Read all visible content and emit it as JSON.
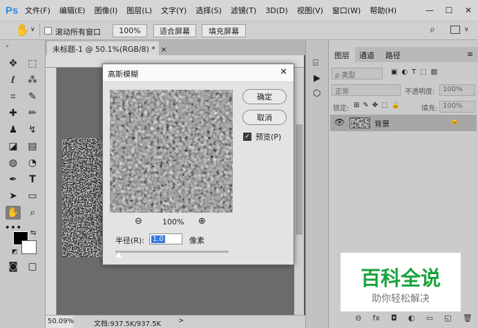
{
  "app": {
    "logo": "Ps"
  },
  "menu": [
    "文件(F)",
    "编辑(E)",
    "图像(I)",
    "图层(L)",
    "文字(Y)",
    "选择(S)",
    "滤镜(T)",
    "3D(D)",
    "视图(V)",
    "窗口(W)",
    "帮助(H)"
  ],
  "window_controls": {
    "minimize": "—",
    "maximize": "☐",
    "close": "✕"
  },
  "options": {
    "scroll_all_windows": "滚动所有窗口",
    "zoom": "100%",
    "fit_screen": "适合屏幕",
    "fill_screen": "填充屏幕"
  },
  "document": {
    "tab_title": "未标题-1 @ 50.1%(RGB/8) *",
    "close": "×",
    "zoom_level": "50.09%",
    "doc_info": "文档:937.5K/937.5K"
  },
  "dialog": {
    "title": "高斯模糊",
    "ok": "确定",
    "cancel": "取消",
    "preview_label": "预览(P)",
    "zoom": "100%",
    "radius_label": "半径(R):",
    "radius_value": "1.0",
    "radius_unit": "像素",
    "close": "✕"
  },
  "layers_panel": {
    "tabs": [
      "图层",
      "通道",
      "路径"
    ],
    "filter_kind": "ρ 类型",
    "blend_mode": "正常",
    "opacity_label": "不透明度:",
    "opacity_value": "100%",
    "lock_label": "锁定:",
    "fill_label": "填充:",
    "fill_value": "100%",
    "layer_name": "背景",
    "footer_icons": [
      "⊖",
      "fx",
      "◘",
      "◐",
      "▭",
      "◱",
      "🗑"
    ]
  },
  "watermark": {
    "line1": "百科全说",
    "line2": "助你轻松解决"
  },
  "colors": {
    "watermark_green": "#1aa33c",
    "ps_blue": "#2d8ceb"
  }
}
